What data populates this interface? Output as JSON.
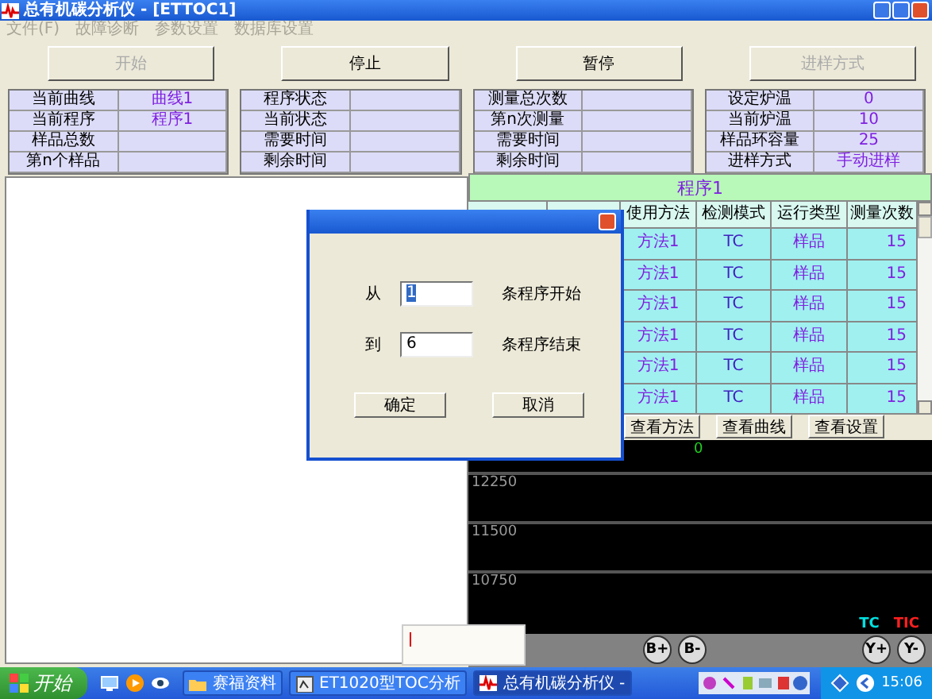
{
  "window": {
    "title": "总有机碳分析仪 - [ETTOC1]"
  },
  "menu": [
    {
      "label": "文件(F)",
      "disabled": true
    },
    {
      "label": "故障诊断",
      "disabled": true
    },
    {
      "label": "参数设置",
      "disabled": true
    },
    {
      "label": "数据库设置",
      "disabled": true
    }
  ],
  "toolbar": [
    {
      "label": "开始",
      "disabled": true
    },
    {
      "label": "停止",
      "disabled": false
    },
    {
      "label": "暂停",
      "disabled": false
    },
    {
      "label": "进样方式",
      "disabled": true
    }
  ],
  "info_tables": [
    [
      {
        "label": "当前曲线",
        "value": "曲线1"
      },
      {
        "label": "当前程序",
        "value": "程序1"
      },
      {
        "label": "样品总数"
      },
      {
        "label": "第n个样品"
      }
    ],
    [
      {
        "label": "程序状态"
      },
      {
        "label": "当前状态"
      },
      {
        "label": "需要时间"
      },
      {
        "label": "剩余时间"
      }
    ],
    [
      {
        "label": "测量总次数"
      },
      {
        "label": "第n次测量"
      },
      {
        "label": "需要时间"
      },
      {
        "label": "剩余时间"
      }
    ],
    [
      {
        "label": "设定炉温",
        "value": "0"
      },
      {
        "label": "当前炉温",
        "value": "10"
      },
      {
        "label": "样品环容量",
        "value": "25"
      },
      {
        "label": "进样方式",
        "value": "手动进样"
      }
    ]
  ],
  "program": {
    "title": "程序1",
    "columns": [
      "使用方法",
      "检测模式",
      "运行类型",
      "测量次数"
    ],
    "rows": [
      [
        "方法1",
        "TC",
        "样品",
        "15"
      ],
      [
        "方法1",
        "TC",
        "样品",
        "15"
      ],
      [
        "方法1",
        "TC",
        "样品",
        "15"
      ],
      [
        "方法1",
        "TC",
        "样品",
        "15"
      ],
      [
        "方法1",
        "TC",
        "样品",
        "15"
      ],
      [
        "方法1",
        "TC",
        "样品",
        "15"
      ]
    ]
  },
  "view_buttons": [
    "查看方法",
    "查看曲线",
    "查看设置"
  ],
  "chart": {
    "top_label": "0",
    "y_labels": [
      "12250",
      "11500",
      "10750"
    ],
    "legend": [
      {
        "label": "TC",
        "color": "#00e0e0"
      },
      {
        "label": "TIC",
        "color": "#ff2020"
      }
    ]
  },
  "chart_controls": [
    "B+",
    "B-",
    "Y+",
    "Y-"
  ],
  "dialog": {
    "rows": [
      {
        "label": "从",
        "value": "1",
        "highlighted": true,
        "suffix": "条程序开始"
      },
      {
        "label": "到",
        "value": "6",
        "highlighted": false,
        "suffix": "条程序结束"
      }
    ],
    "buttons": [
      "确定",
      "取消"
    ]
  },
  "taskbar": {
    "start": "开始",
    "tasks": [
      {
        "label": "赛福资料",
        "active": false
      },
      {
        "label": "ET1020型TOC分析",
        "active": false
      },
      {
        "label": "总有机碳分析仪 -",
        "active": true
      }
    ],
    "clock": "15:06"
  }
}
